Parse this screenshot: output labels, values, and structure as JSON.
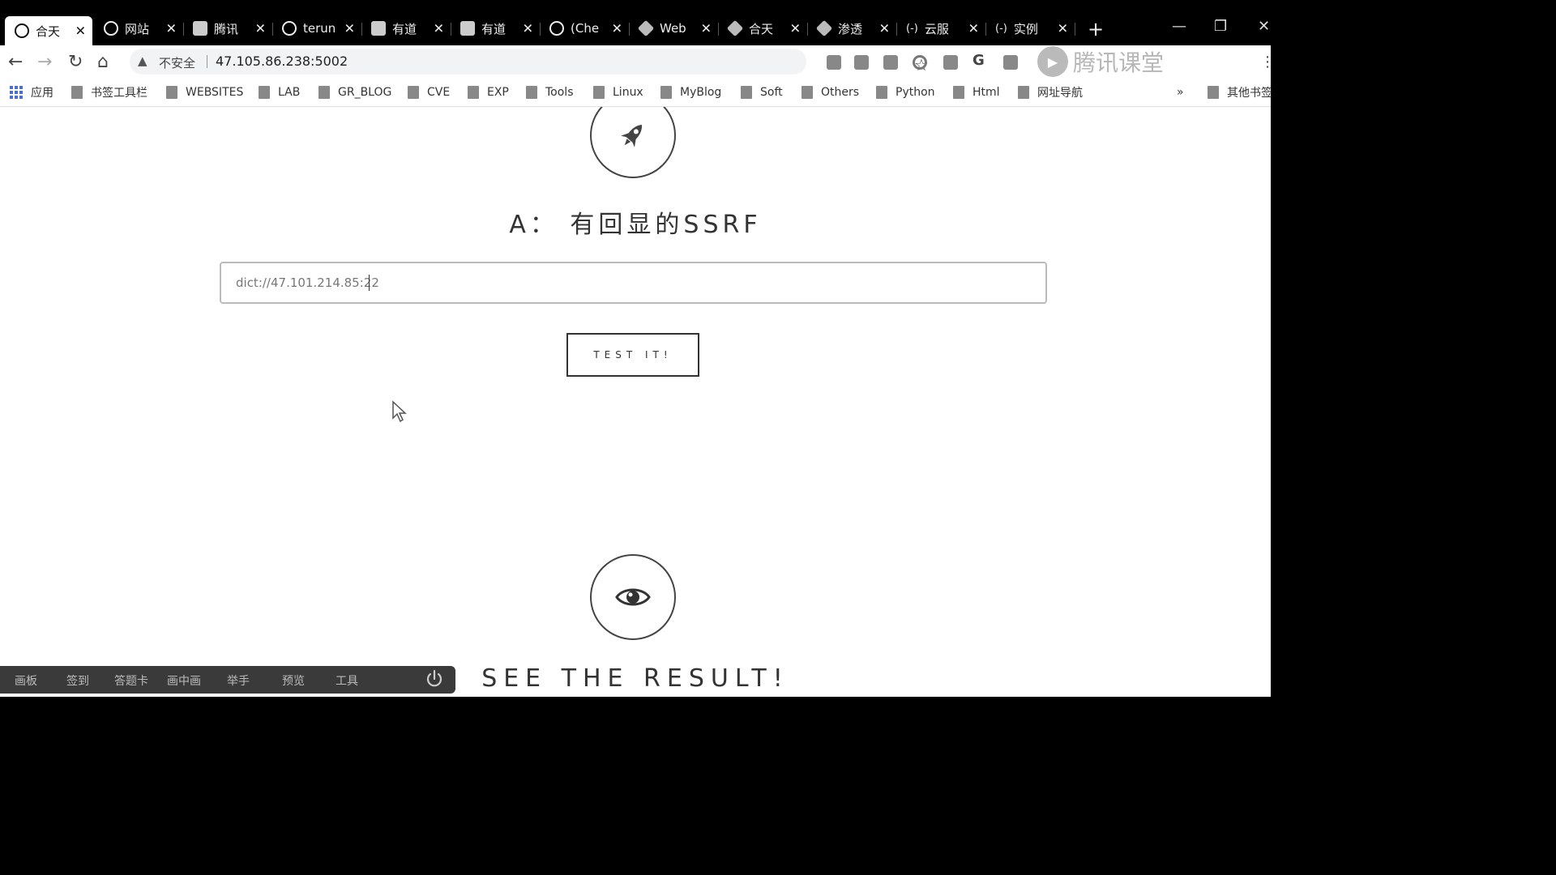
{
  "tabs": [
    {
      "title": "合天",
      "icon": "globe-icon",
      "active": true
    },
    {
      "title": "网站",
      "icon": "globe-icon"
    },
    {
      "title": "腾讯",
      "icon": "doc-icon"
    },
    {
      "title": "terun",
      "icon": "github-icon"
    },
    {
      "title": "有道",
      "icon": "doc-icon"
    },
    {
      "title": "有道",
      "icon": "doc-icon"
    },
    {
      "title": "(Che",
      "icon": "globe-icon"
    },
    {
      "title": "Web",
      "icon": "gem-icon"
    },
    {
      "title": "合天",
      "icon": "gem-icon"
    },
    {
      "title": "渗透",
      "icon": "gem-icon"
    },
    {
      "title": "云服",
      "icon": "code-icon"
    },
    {
      "title": "实例",
      "icon": "code-icon"
    }
  ],
  "new_tab_label": "+",
  "window_controls": {
    "minimize": "—",
    "restore": "❐",
    "close": "✕"
  },
  "toolbar": {
    "insecure_label": "不安全",
    "url": "47.105.86.238:5002",
    "watermark": "腾讯课堂"
  },
  "bookmarks": {
    "apps_label": "应用",
    "items": [
      "书签工具栏",
      "WEBSITES",
      "LAB",
      "GR_BLOG",
      "CVE",
      "EXP",
      "Tools",
      "Linux",
      "MyBlog",
      "Soft",
      "Others",
      "Python",
      "Html",
      "网址导航"
    ],
    "more_label": "»",
    "other_label": "其他书签"
  },
  "page": {
    "heading": "A： 有回显的SSRF",
    "input_value": "dict://47.101.214.85:22",
    "button_label": "TEST IT!",
    "result_title": "SEE THE RESULT!"
  },
  "classroom_bar": {
    "items": [
      "画板",
      "签到",
      "答题卡",
      "画中画",
      "举手",
      "预览",
      "工具"
    ]
  }
}
